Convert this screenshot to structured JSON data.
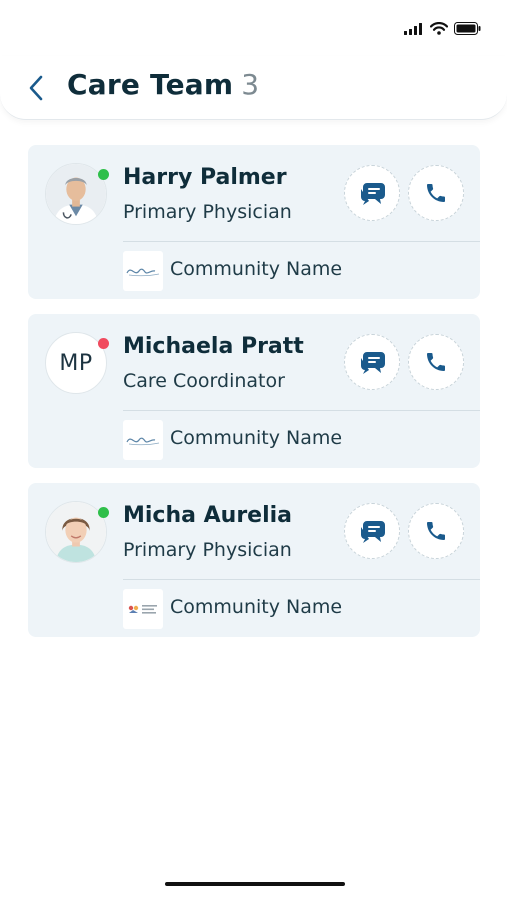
{
  "header": {
    "title": "Care Team",
    "count": "3"
  },
  "colors": {
    "accent": "#1a5a8c",
    "online": "#2fbf4a",
    "busy": "#f04a5e",
    "card_bg": "#eef4f8"
  },
  "icons": {
    "back": "chevron-left-icon",
    "message": "chat-bubbles-icon",
    "call": "phone-icon"
  },
  "team": [
    {
      "name": "Harry Palmer",
      "role": "Primary Physician",
      "community": "Community Name",
      "status": "online",
      "avatar": "photo"
    },
    {
      "name": "Michaela Pratt",
      "role": "Care Coordinator",
      "community": "Community Name",
      "status": "busy",
      "initials": "MP"
    },
    {
      "name": "Micha Aurelia",
      "role": "Primary Physician",
      "community": "Community Name",
      "status": "online",
      "avatar": "photo"
    }
  ]
}
